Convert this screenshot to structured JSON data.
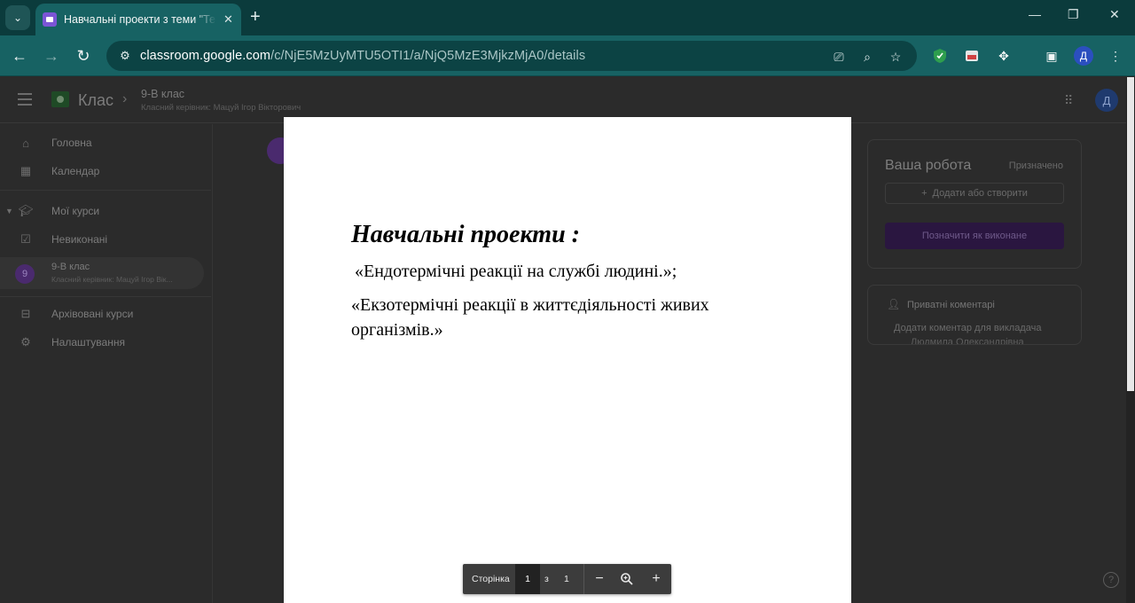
{
  "browser": {
    "tab_title": "Навчальні проекти з теми \"Тепловий ефект хімічних реакцій\"",
    "tab_close": "✕",
    "new_tab": "+",
    "url_host": "classroom.google.com",
    "url_path": "/c/NjE5MzUyMTU5OTI1/a/NjQ5MzE3MjkzMjA0/details",
    "profile_initial": "Д",
    "icons": [
      "tab-search-icon",
      "back-icon",
      "forward-icon",
      "reload-icon",
      "site-info-icon",
      "install-app-icon",
      "zoom-icon",
      "bookmark-star-icon",
      "shield-extension-icon",
      "extension-icon-2",
      "puzzle-extensions-icon",
      "side-panel-icon",
      "menu-dots-icon"
    ]
  },
  "header": {
    "app_name": "Клас",
    "class_title": "9-В клас",
    "class_subtitle": "Класний керівник: Мацуй Ігор Вікторович",
    "avatar_initial": "Д"
  },
  "sidebar": {
    "home": "Головна",
    "calendar": "Календар",
    "my_courses": "Мої курси",
    "todo": "Невиконані",
    "class_name": "9-В клас",
    "class_sub": "Класний керівник: Мацуй Ігор Вік...",
    "class_avatar": "9",
    "archived": "Архівовані курси",
    "settings": "Налаштування"
  },
  "work_panel": {
    "title": "Ваша робота",
    "status": "Призначено",
    "add_label": "Додати або створити",
    "mark_done": "Позначити як виконане"
  },
  "comments_panel": {
    "title": "Приватні коментарі",
    "add_label": "Додати коментар для викладача",
    "teacher": "Людмила Олександрівна"
  },
  "document": {
    "heading": "Навчальні проекти :",
    "line1": "«Ендотермічні реакції на службі людині.»;",
    "line2": "«Екзотермічні реакції в життєдіяльності живих організмів.»"
  },
  "pager": {
    "label": "Сторінка",
    "current": "1",
    "of": "з",
    "total": "1"
  },
  "colors": {
    "tab_strip": "#0b3b3c",
    "toolbar": "#176263",
    "page_dimmed": "#2b2b2b",
    "pager_bg": "#3c3c3c"
  }
}
